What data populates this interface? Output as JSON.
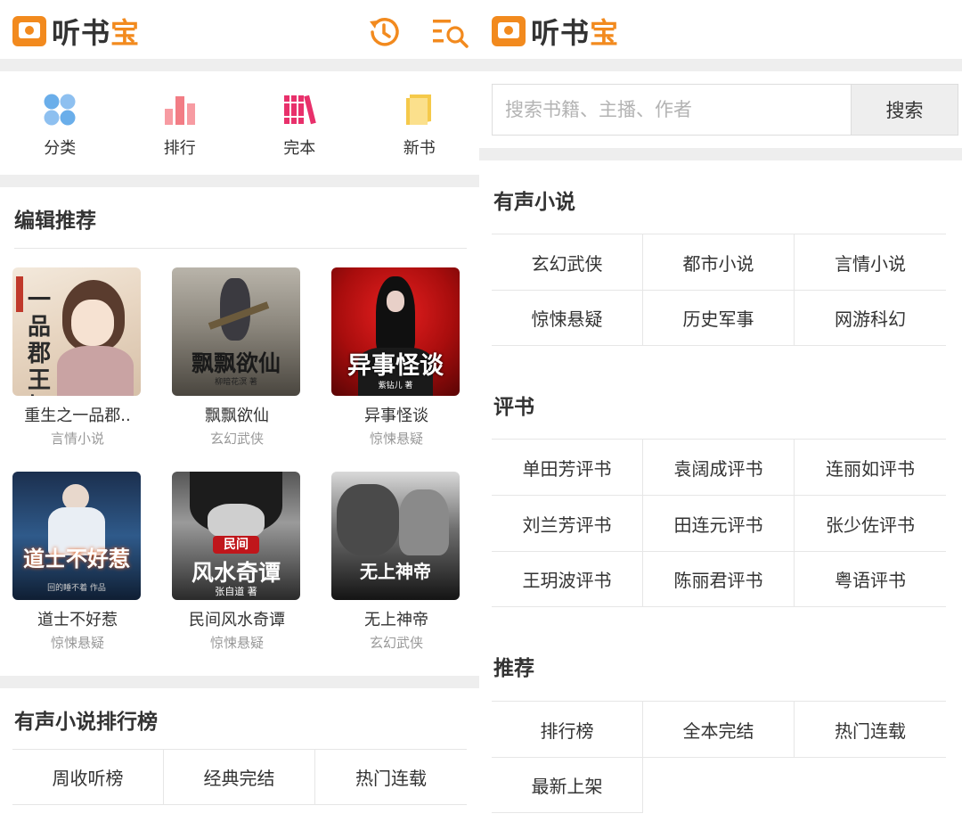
{
  "app": {
    "logo_text_1": "听书",
    "logo_text_2": "宝",
    "accent": "#f28a1e"
  },
  "left": {
    "header_icons": [
      "history-icon",
      "search-list-icon"
    ],
    "quick_nav": [
      {
        "label": "分类",
        "icon": "category-icon",
        "color": "#6aaeea"
      },
      {
        "label": "排行",
        "icon": "ranking-icon",
        "color": "#f27d85"
      },
      {
        "label": "完本",
        "icon": "books-icon",
        "color": "#e8306b"
      },
      {
        "label": "新书",
        "icon": "new-book-icon",
        "color": "#f5c94a"
      }
    ],
    "editor_picks": {
      "title": "编辑推荐",
      "books": [
        {
          "title": "重生之一品郡..",
          "category": "言情小说",
          "cover_text": "一品郡王妃",
          "cover_author": ""
        },
        {
          "title": "飘飘欲仙",
          "category": "玄幻武侠",
          "cover_text": "飘飘欲仙",
          "cover_author": "柳暗花溟 著"
        },
        {
          "title": "异事怪谈",
          "category": "惊悚悬疑",
          "cover_text": "异事怪谈",
          "cover_author": "紫钻儿 著"
        },
        {
          "title": "道士不好惹",
          "category": "惊悚悬疑",
          "cover_text": "道士不好惹",
          "cover_author": "回的睡不着 作品"
        },
        {
          "title": "民间风水奇谭",
          "category": "惊悚悬疑",
          "cover_text": "风水奇谭",
          "cover_author": "张自道 著"
        },
        {
          "title": "无上神帝",
          "category": "玄幻武侠",
          "cover_text": "无上神帝",
          "cover_author": ""
        }
      ],
      "cover_badge": "民间"
    },
    "ranking": {
      "title": "有声小说排行榜",
      "tabs": [
        "周收听榜",
        "经典完结",
        "热门连载"
      ]
    }
  },
  "right": {
    "search": {
      "placeholder": "搜索书籍、主播、作者",
      "value": "",
      "button": "搜索"
    },
    "sections": [
      {
        "title": "有声小说",
        "items": [
          "玄幻武侠",
          "都市小说",
          "言情小说",
          "惊悚悬疑",
          "历史军事",
          "网游科幻"
        ]
      },
      {
        "title": "评书",
        "items": [
          "单田芳评书",
          "袁阔成评书",
          "连丽如评书",
          "刘兰芳评书",
          "田连元评书",
          "张少佐评书",
          "王玥波评书",
          "陈丽君评书",
          "粤语评书"
        ]
      },
      {
        "title": "推荐",
        "items": [
          "排行榜",
          "全本完结",
          "热门连载",
          "最新上架"
        ]
      }
    ]
  }
}
